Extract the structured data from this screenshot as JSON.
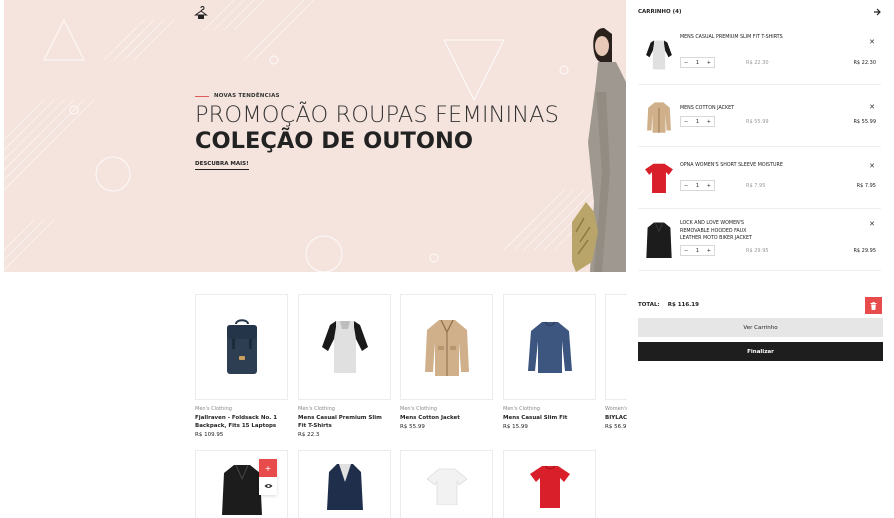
{
  "hero": {
    "subtitle": "NOVAS TENDÊNCIAS",
    "title_line1": "PROMOÇÃO ROUPAS FEMININAS",
    "title_line2": "COLEÇÃO DE OUTONO",
    "link": "DESCUBRA MAIS!"
  },
  "products": [
    {
      "category": "Men's Clothing",
      "name": "Fjallraven - Foldsack No. 1 Backpack, Fits 15 Laptops",
      "price": "R$ 109.95",
      "icon": "backpack-icon"
    },
    {
      "category": "Men's Clothing",
      "name": "Mens Casual Premium Slim Fit T-Shirts",
      "price": "R$ 22.3",
      "icon": "raglan-shirt-icon"
    },
    {
      "category": "Men's Clothing",
      "name": "Mens Cotton Jacket",
      "price": "R$ 55.99",
      "icon": "cotton-jacket-icon"
    },
    {
      "category": "Men's Clothing",
      "name": "Mens Casual Slim Fit",
      "price": "R$ 15.99",
      "icon": "long-sleeve-shirt-icon"
    },
    {
      "category": "Women's",
      "name": "BIYLAC",
      "price": "R$ 56.9",
      "icon": "product-icon"
    }
  ],
  "products_row2": [
    "leather-jacket-icon",
    "blazer-icon",
    "white-top-icon",
    "red-tshirt-icon"
  ],
  "quick": {
    "add": "+"
  },
  "cart": {
    "title": "CARRINHO (4)",
    "items": [
      {
        "name": "Mens Casual Premium Slim Fit T-Shirts",
        "qty": "1",
        "old_price": "R$ 22.30",
        "price": "R$ 22.30"
      },
      {
        "name": "Mens Cotton Jacket",
        "qty": "1",
        "old_price": "R$ 55.99",
        "price": "R$ 55.99"
      },
      {
        "name": "Opna Women's Short Sleeve Moisture",
        "qty": "1",
        "old_price": "R$ 7.95",
        "price": "R$ 7.95"
      },
      {
        "name": "Lock and Love Women's Removable Hooded Faux Leather Moto Biker Jacket",
        "qty": "1",
        "old_price": "R$ 29.95",
        "price": "R$ 29.95"
      }
    ],
    "total_label": "TOTAL:",
    "total_value": "R$ 116.19",
    "view_cart": "Ver Carrinho",
    "checkout": "Finalizar",
    "minus": "−",
    "plus": "+",
    "remove": "✕"
  },
  "colors": {
    "accent": "#e84b4b",
    "hero_bg": "#f5e4de",
    "dark": "#1e1e1e"
  }
}
